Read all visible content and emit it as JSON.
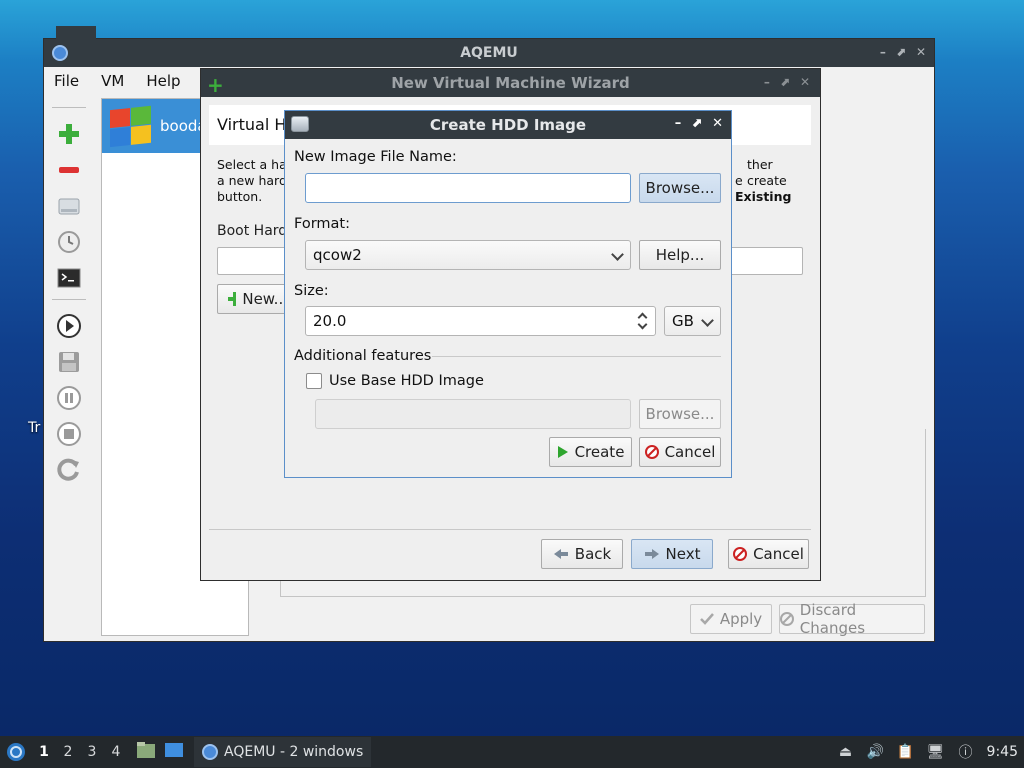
{
  "desktop": {
    "label": "Tr"
  },
  "main_window": {
    "title": "AQEMU",
    "menus": [
      "File",
      "VM",
      "Help"
    ],
    "vm_list": [
      {
        "name": "booda"
      }
    ],
    "buttons": {
      "apply": "Apply",
      "discard": "Discard Changes"
    }
  },
  "wizard": {
    "title": "New Virtual Machine Wizard",
    "header": "Virtual Ha",
    "description_line1": "Select a har",
    "description_line1_right": "ther create",
    "description_line2": "a new hard",
    "description_line2_right": "e ",
    "description_line2_bold": "Existing",
    "description_line3": "button.",
    "boot_label": "Boot Hard",
    "new_button": "New...",
    "buttons": {
      "back": "Back",
      "next": "Next",
      "cancel": "Cancel"
    }
  },
  "hdd_dialog": {
    "title": "Create HDD Image",
    "file_name_label": "New Image File Name:",
    "file_name_value": "",
    "browse": "Browse...",
    "format_label": "Format:",
    "format_value": "qcow2",
    "help": "Help...",
    "size_label": "Size:",
    "size_value": "20.0",
    "size_unit": "GB",
    "additional_label": "Additional features",
    "use_base_label": "Use Base HDD Image",
    "use_base_checked": false,
    "base_browse": "Browse...",
    "create": "Create",
    "cancel": "Cancel"
  },
  "taskbar": {
    "workspaces": [
      "1",
      "2",
      "3",
      "4"
    ],
    "active_workspace": "1",
    "task_label": "AQEMU - 2 windows",
    "clock": "9:45"
  },
  "colors": {
    "accent": "#3a8fd6",
    "titlebar": "#333b41",
    "taskbar": "#23282c"
  }
}
